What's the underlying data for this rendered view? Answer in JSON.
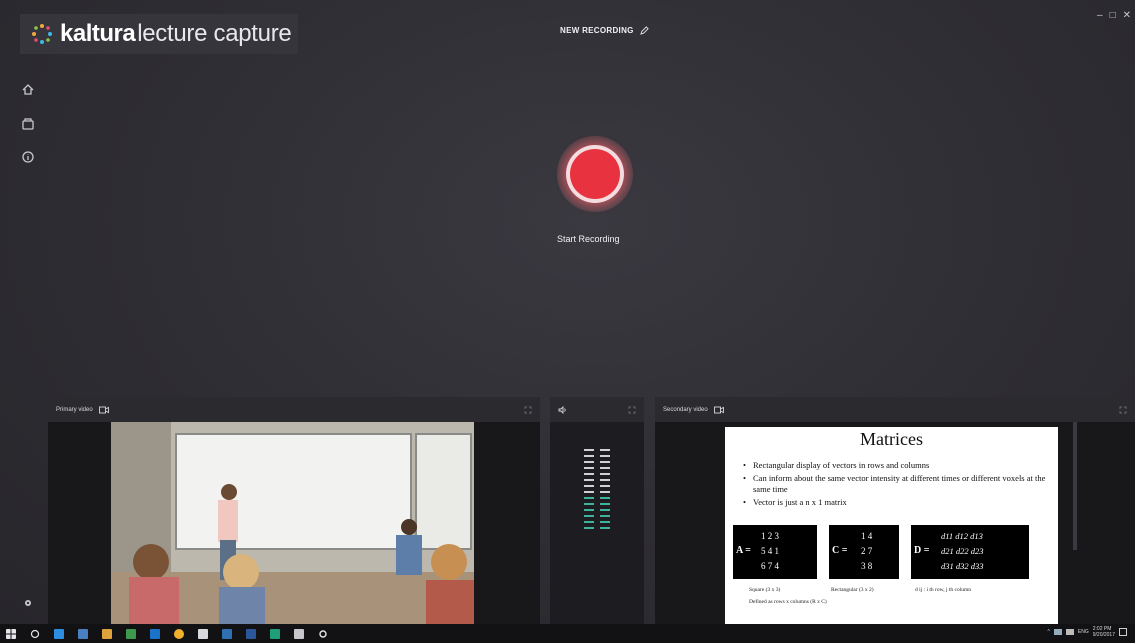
{
  "app": {
    "logo_brand": "kaltura",
    "logo_product": "lecture capture",
    "recording_title": "NEW RECORDING",
    "window_controls": [
      "–",
      "□",
      "✕"
    ],
    "accent_color": "#e8323f"
  },
  "sidebar": {
    "icons": [
      "home-icon",
      "library-icon",
      "info-icon",
      "settings-icon"
    ]
  },
  "main": {
    "start_label": "Start Recording"
  },
  "panels": {
    "primary_label": "Primary video",
    "secondary_label": "Secondary video",
    "audio_level_bars": 14,
    "audio_active_bars": 6
  },
  "slide": {
    "title": "Matrices",
    "bullets": [
      "Rectangular display of vectors in rows and columns",
      "Can inform about the same vector intensity at different times or different voxels at the same time",
      "Vector is just a n x 1 matrix"
    ],
    "matrix_a_label": "A =",
    "matrix_a_rows": [
      "1  2  3",
      "5  4  1",
      "6  7  4"
    ],
    "matrix_c_label": "C =",
    "matrix_c_rows": [
      "1  4",
      "2  7",
      "3  8"
    ],
    "matrix_d_label": "D =",
    "matrix_d_rows": [
      "d11  d12  d13",
      "d21  d22  d23",
      "d31  d32  d33"
    ],
    "caption_a": "Square (3 x 3)",
    "caption_c": "Rectangular (3 x 2)",
    "caption_d": "d ij : i th row, j th column",
    "caption_bottom": "Defined as rows x columns (R x C)"
  },
  "taskbar": {
    "tray_lang": "ENG",
    "tray_time": "2:02 PM",
    "tray_date": "9/20/2017"
  }
}
